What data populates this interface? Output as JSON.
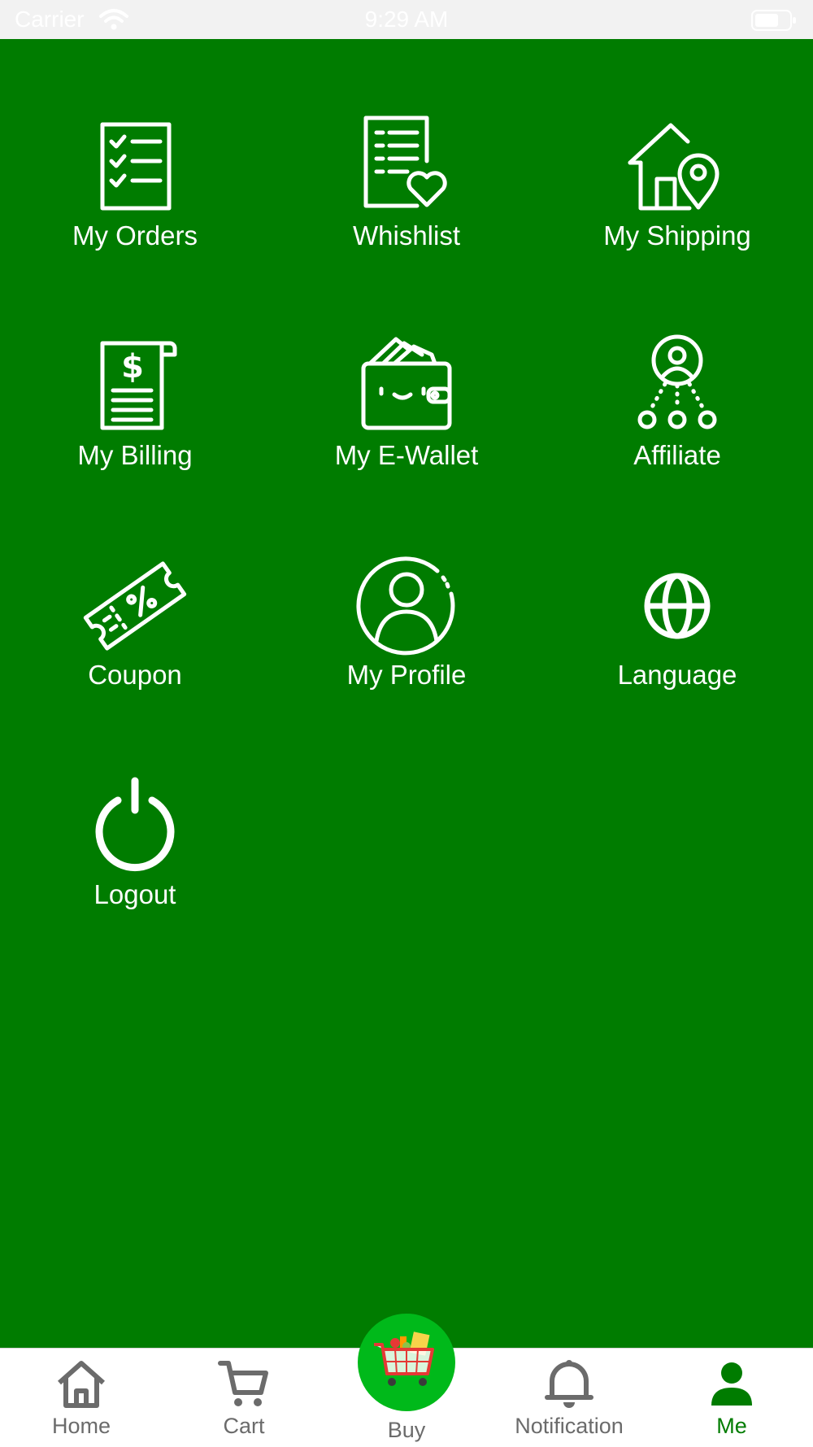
{
  "status_bar": {
    "carrier": "Carrier",
    "time": "9:29 AM"
  },
  "menu": {
    "my_orders": "My Orders",
    "wishlist": "Whishlist",
    "my_shipping": "My Shipping",
    "my_billing": "My Billing",
    "my_ewallet": "My E-Wallet",
    "affiliate": "Affiliate",
    "coupon": "Coupon",
    "my_profile": "My Profile",
    "language": "Language",
    "logout": "Logout"
  },
  "tab_bar": {
    "home": "Home",
    "cart": "Cart",
    "buy": "Buy",
    "notification": "Notification",
    "me": "Me",
    "active": "Me"
  },
  "colors": {
    "background": "#007c00",
    "accent": "#00b91a",
    "tab_inactive": "#6b6b6b",
    "tab_active": "#007c00"
  }
}
